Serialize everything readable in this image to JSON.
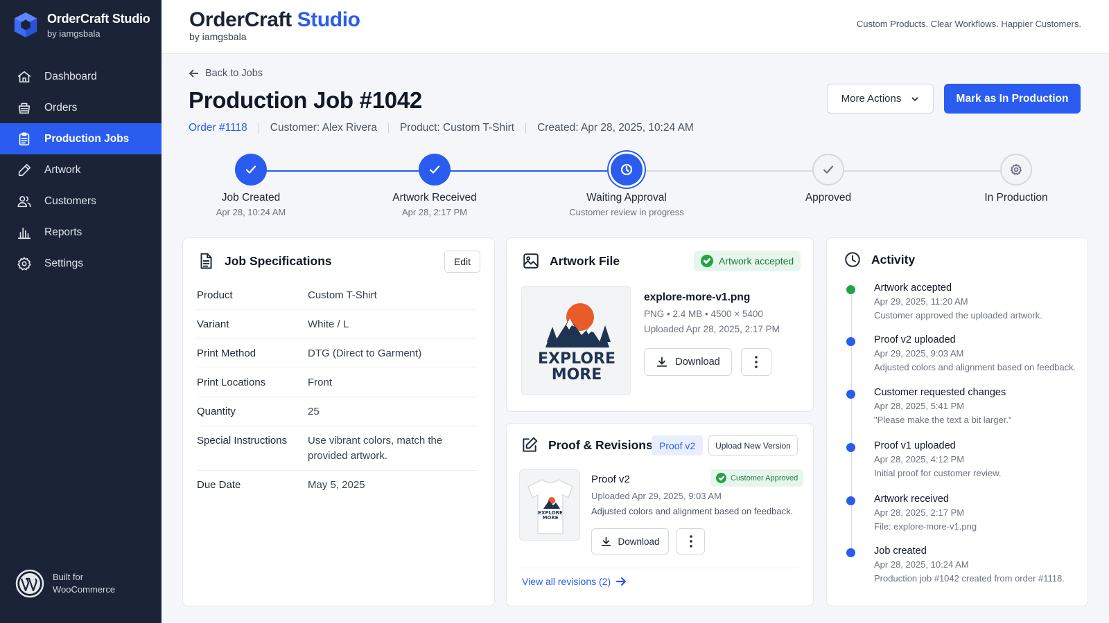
{
  "app": {
    "name": "OrderCraft Studio",
    "byline": "by iamgsbala",
    "title_part1": "OrderCraft",
    "title_part2": "Studio",
    "tagline": "Custom Products. Clear Workflows. Happier Customers.",
    "accent_color": "#2a5cf0",
    "sidebar_color": "#1b2437"
  },
  "sidebar": {
    "items": [
      {
        "label": "Dashboard",
        "icon": "home-icon",
        "active": false
      },
      {
        "label": "Orders",
        "icon": "basket-icon",
        "active": false
      },
      {
        "label": "Production Jobs",
        "icon": "clipboard-icon",
        "active": true
      },
      {
        "label": "Artwork",
        "icon": "pencil-icon",
        "active": false
      },
      {
        "label": "Customers",
        "icon": "users-icon",
        "active": false
      },
      {
        "label": "Reports",
        "icon": "bar-chart-icon",
        "active": false
      },
      {
        "label": "Settings",
        "icon": "gear-icon",
        "active": false
      }
    ],
    "built_for_line1": "Built for",
    "built_for_line2": "WooCommerce"
  },
  "header": {
    "back_label": "Back to Jobs",
    "title": "Production Job #1042",
    "order_prefix": "Order ",
    "order_link": "#1118",
    "customer": "Customer: Alex Rivera",
    "product": "Product: Custom T-Shirt",
    "created": "Created: Apr 28, 2025, 10:24 AM",
    "more_actions_label": "More Actions",
    "primary_action_label": "Mark as In Production"
  },
  "stepper": {
    "steps": [
      {
        "label": "Job Created",
        "date": "Apr 28, 10:24 AM",
        "state": "done"
      },
      {
        "label": "Artwork Received",
        "date": "Apr 28, 2:17 PM",
        "state": "done"
      },
      {
        "label": "Waiting Approval",
        "date": "Customer review in progress",
        "state": "current"
      },
      {
        "label": "Approved",
        "date": "",
        "state": "todo"
      },
      {
        "label": "In Production",
        "date": "",
        "state": "todo"
      }
    ]
  },
  "specs": {
    "title": "Job Specifications",
    "edit_label": "Edit",
    "rows": [
      {
        "key": "Product",
        "value": "Custom T-Shirt"
      },
      {
        "key": "Variant",
        "value": "White / L"
      },
      {
        "key": "Print Method",
        "value": "DTG (Direct to Garment)"
      },
      {
        "key": "Print Locations",
        "value": "Front"
      },
      {
        "key": "Quantity",
        "value": "25"
      },
      {
        "key": "Special Instructions",
        "value": "Use vibrant colors, match the provided artwork."
      },
      {
        "key": "Due Date",
        "value": "May 5, 2025"
      }
    ]
  },
  "artwork": {
    "title": "Artwork File",
    "badge": "Artwork accepted",
    "file_name": "explore-more-v1.png",
    "file_meta": "PNG • 2.4 MB • 4500 × 5400",
    "uploaded": "Uploaded Apr 28, 2025, 2:17 PM",
    "download_label": "Download",
    "art_line1": "EXPLORE",
    "art_line2": "MORE"
  },
  "proofs": {
    "title": "Proof & Revisions",
    "pill": "Proof v2",
    "upload_label": "Upload New Version",
    "proof_name": "Proof v2",
    "badge": "Customer Approved",
    "uploaded": "Uploaded Apr 29, 2025, 9:03 AM",
    "note": "Adjusted colors and alignment based on feedback.",
    "download_label": "Download",
    "view_all_label": "View all revisions (2)",
    "shirt_line1": "EXPLORE",
    "shirt_line2": "MORE"
  },
  "activity": {
    "title": "Activity",
    "items": [
      {
        "title": "Artwork accepted",
        "date": "Apr 29, 2025, 11:20 AM",
        "desc": "Customer approved the uploaded artwork.",
        "color": "#22a447"
      },
      {
        "title": "Proof v2 uploaded",
        "date": "Apr 29, 2025, 9:03 AM",
        "desc": "Adjusted colors and alignment based on feedback.",
        "color": "#2a5cf0"
      },
      {
        "title": "Customer requested changes",
        "date": "Apr 28, 2025, 5:41 PM",
        "desc": "\"Please make the text a bit larger.\"",
        "color": "#2a5cf0"
      },
      {
        "title": "Proof v1 uploaded",
        "date": "Apr 28, 2025, 4:12 PM",
        "desc": "Initial proof for customer review.",
        "color": "#2a5cf0"
      },
      {
        "title": "Artwork received",
        "date": "Apr 28, 2025, 2:17 PM",
        "desc": "File: explore-more-v1.png",
        "color": "#2a5cf0"
      },
      {
        "title": "Job created",
        "date": "Apr 28, 2025, 10:24 AM",
        "desc": "Production job #1042 created from order #1118.",
        "color": "#2a5cf0"
      }
    ]
  }
}
